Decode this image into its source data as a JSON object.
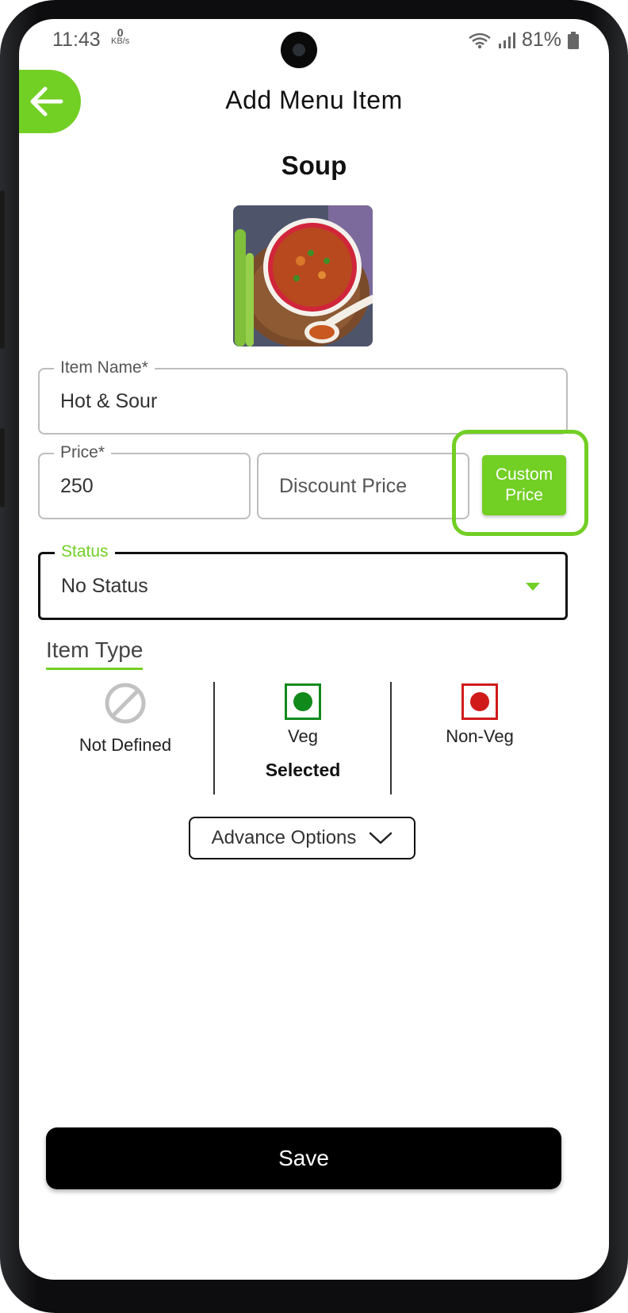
{
  "status_bar": {
    "time": "11:43",
    "net_speed_value": "0",
    "net_speed_unit": "KB/s",
    "battery": "81%",
    "icons": [
      "wifi-icon",
      "signal-icon",
      "battery-icon"
    ]
  },
  "header": {
    "title": "Add Menu Item",
    "back_icon": "arrow-left-icon"
  },
  "category": "Soup",
  "image": {
    "subject": "food-photo-soup"
  },
  "form": {
    "item_name": {
      "label": "Item Name*",
      "value": "Hot & Sour"
    },
    "price": {
      "label": "Price*",
      "value": "250"
    },
    "discount_price": {
      "placeholder": "Discount Price"
    },
    "custom_price": {
      "label": "Custom Price"
    },
    "status": {
      "label": "Status",
      "value": "No Status"
    }
  },
  "item_type": {
    "title": "Item Type",
    "options": [
      {
        "label": "Not Defined",
        "icon": "not-allowed-icon"
      },
      {
        "label": "Veg",
        "icon": "veg-icon",
        "selected_text": "Selected"
      },
      {
        "label": "Non-Veg",
        "icon": "non-veg-icon"
      }
    ]
  },
  "advance_options": {
    "label": "Advance Options",
    "icon": "chevron-down-icon"
  },
  "save": {
    "label": "Save"
  },
  "colors": {
    "accent": "#72cf24",
    "veg": "#118a1c",
    "non_veg": "#d01a1a",
    "button_dark": "#000000"
  }
}
